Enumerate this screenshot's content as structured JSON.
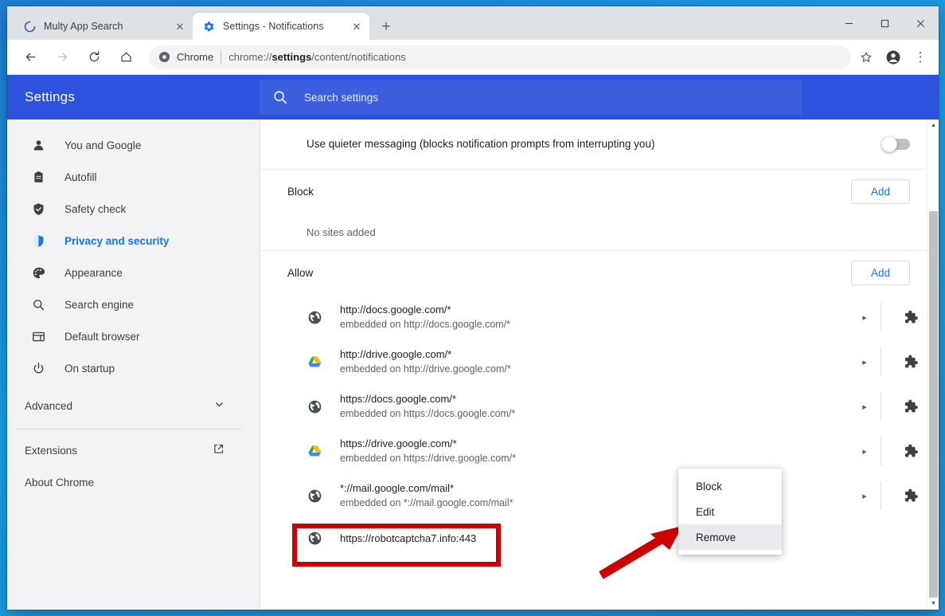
{
  "window": {
    "controls": {
      "minimize": "–",
      "maximize": "❐",
      "close": "✕"
    }
  },
  "tabs": [
    {
      "title": "Multy App Search",
      "favicon": "loading-spinner-icon",
      "active": false,
      "close": "✕"
    },
    {
      "title": "Settings - Notifications",
      "favicon": "settings-gear-icon",
      "active": true,
      "close": "✕"
    }
  ],
  "new_tab_label": "+",
  "toolbar": {
    "back": "←",
    "forward": "→",
    "reload": "↻",
    "home": "⌂",
    "omnibox_scheme": "Chrome",
    "omnibox_url_prefix": "chrome://",
    "omnibox_url_bold": "settings",
    "omnibox_url_suffix": "/content/notifications",
    "bookmark": "☆",
    "profile": "profile-avatar-icon",
    "menu": "⋮"
  },
  "settings": {
    "title": "Settings",
    "search_placeholder": "Search settings",
    "search_value": ""
  },
  "sidebar": {
    "items": [
      {
        "label": "You and Google",
        "icon": "person-icon",
        "selected": false
      },
      {
        "label": "Autofill",
        "icon": "clipboard-icon",
        "selected": false
      },
      {
        "label": "Safety check",
        "icon": "shield-check-icon",
        "selected": false
      },
      {
        "label": "Privacy and security",
        "icon": "shield-icon",
        "selected": true
      },
      {
        "label": "Appearance",
        "icon": "palette-icon",
        "selected": false
      },
      {
        "label": "Search engine",
        "icon": "search-icon",
        "selected": false
      },
      {
        "label": "Default browser",
        "icon": "browser-window-icon",
        "selected": false
      },
      {
        "label": "On startup",
        "icon": "power-icon",
        "selected": false
      }
    ],
    "advanced": {
      "label": "Advanced",
      "icon": "chevron-down-icon"
    },
    "extensions": {
      "label": "Extensions",
      "icon": "external-link-icon"
    },
    "about": {
      "label": "About Chrome"
    }
  },
  "content": {
    "quieter_messaging": {
      "label": "Use quieter messaging (blocks notification prompts from interrupting you)",
      "enabled": false
    },
    "block_section": {
      "title": "Block",
      "add_label": "Add",
      "empty_text": "No sites added"
    },
    "allow_section": {
      "title": "Allow",
      "add_label": "Add"
    },
    "allow_sites": [
      {
        "url": "http://docs.google.com/*",
        "sub": "embedded on http://docs.google.com/*",
        "icon": "globe-icon",
        "arrow": "▸",
        "ext_icon": "puzzle-piece-icon"
      },
      {
        "url": "http://drive.google.com/*",
        "sub": "embedded on http://drive.google.com/*",
        "icon": "google-drive-icon",
        "arrow": "▸",
        "ext_icon": "puzzle-piece-icon"
      },
      {
        "url": "https://docs.google.com/*",
        "sub": "embedded on https://docs.google.com/*",
        "icon": "globe-icon",
        "arrow": "▸",
        "ext_icon": "puzzle-piece-icon"
      },
      {
        "url": "https://drive.google.com/*",
        "sub": "embedded on https://drive.google.com/*",
        "icon": "google-drive-icon",
        "arrow": "▸",
        "ext_icon": "puzzle-piece-icon"
      },
      {
        "url": "*://mail.google.com/mail*",
        "sub": "embedded on *://mail.google.com/mail*",
        "icon": "globe-icon",
        "arrow": "▸",
        "ext_icon": "puzzle-piece-icon"
      },
      {
        "url": "https://robotcaptcha7.info:443",
        "sub": "",
        "icon": "globe-icon",
        "arrow": "",
        "ext_icon": "",
        "highlighted": true
      }
    ]
  },
  "context_menu": {
    "items": [
      {
        "label": "Block",
        "highlighted": false
      },
      {
        "label": "Edit",
        "highlighted": false
      },
      {
        "label": "Remove",
        "highlighted": true
      }
    ]
  },
  "annotations": {
    "highlight_color": "#cc0000",
    "arrow_color": "#cc0000"
  },
  "colors": {
    "settings_header_blue": "#2d52dd",
    "accent_blue": "#1a73e8",
    "tabstrip_gray": "#dee1e6",
    "sidebar_gray": "#f1f3f4"
  },
  "scrollbar": {
    "up": "▲",
    "down": "▼"
  }
}
